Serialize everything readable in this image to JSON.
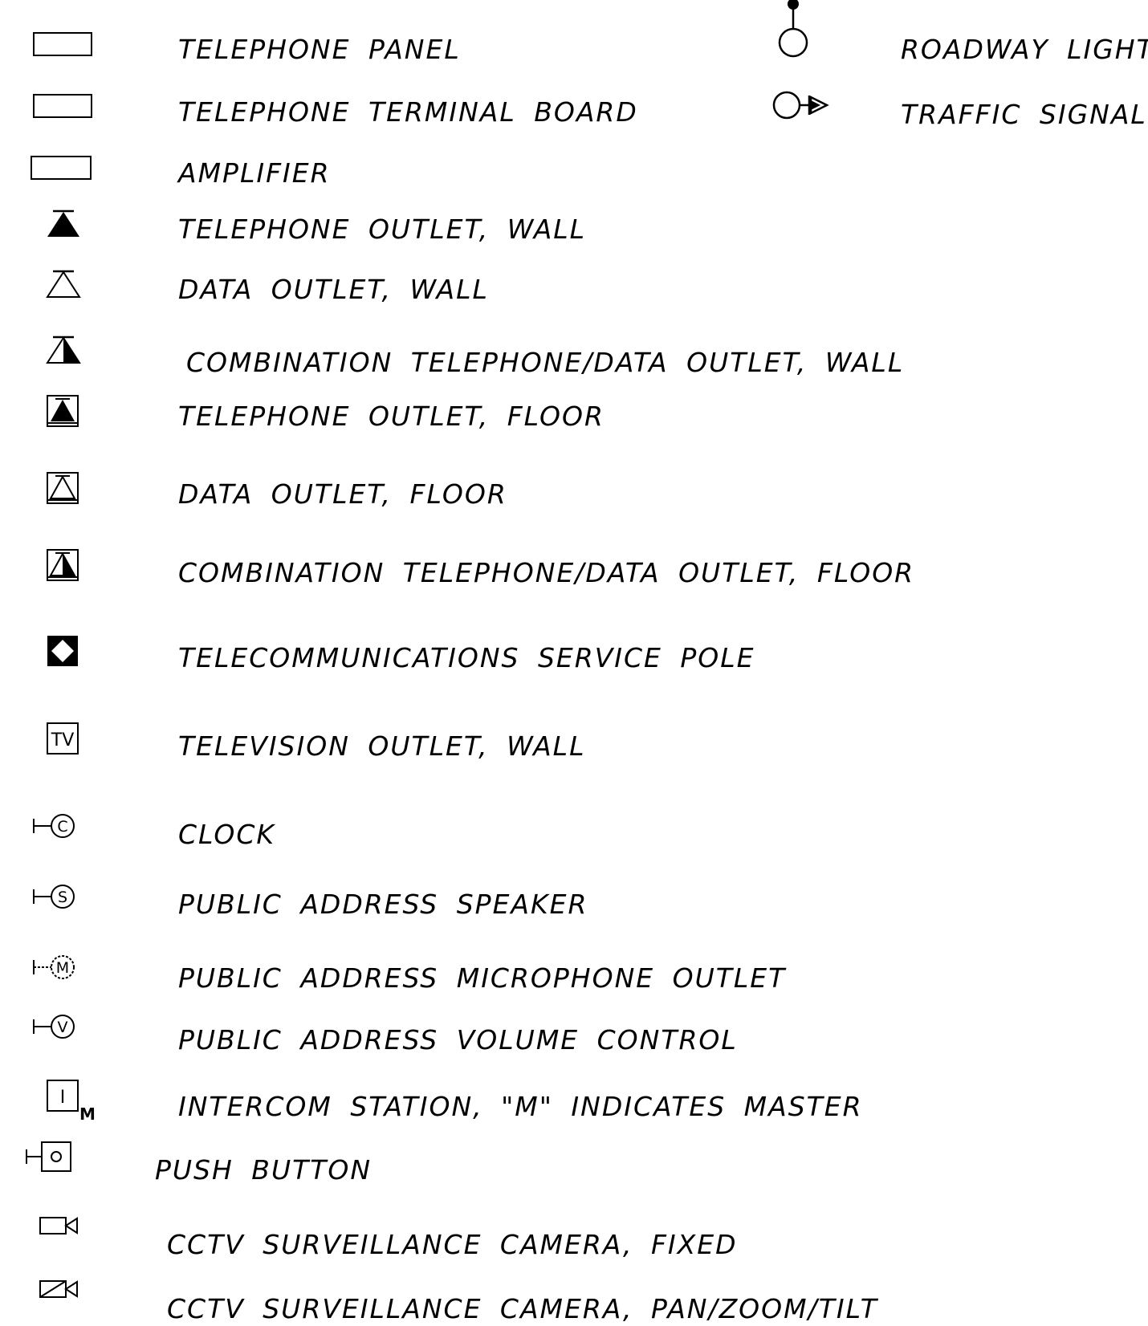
{
  "legend_left": [
    {
      "symbol": "panel-rect-icon",
      "label": "TELEPHONE  PANEL"
    },
    {
      "symbol": "terminal-board-rect-icon",
      "label": "TELEPHONE  TERMINAL  BOARD"
    },
    {
      "symbol": "amplifier-rect-icon",
      "label": "AMPLIFIER"
    },
    {
      "symbol": "filled-triangle-icon",
      "label": "TELEPHONE  OUTLET, WALL"
    },
    {
      "symbol": "open-triangle-icon",
      "label": "DATA  OUTLET, WALL"
    },
    {
      "symbol": "half-filled-triangle-icon",
      "label": "COMBINATION  TELEPHONE/DATA  OUTLET, WALL"
    },
    {
      "symbol": "boxed-filled-triangle-icon",
      "label": "TELEPHONE  OUTLET, FLOOR"
    },
    {
      "symbol": "boxed-open-triangle-icon",
      "label": "DATA  OUTLET, FLOOR"
    },
    {
      "symbol": "boxed-half-triangle-icon",
      "label": "COMBINATION  TELEPHONE/DATA  OUTLET, FLOOR"
    },
    {
      "symbol": "diamond-in-square-icon",
      "label": "TELECOMMUNICATIONS  SERVICE  POLE"
    },
    {
      "symbol": "tv-box-icon",
      "label": "TELEVISION  OUTLET, WALL",
      "glyph": "TV"
    },
    {
      "symbol": "clock-icon",
      "label": "CLOCK",
      "glyph": "C"
    },
    {
      "symbol": "speaker-icon",
      "label": "PUBLIC  ADDRESS  SPEAKER",
      "glyph": "S"
    },
    {
      "symbol": "microphone-outlet-icon",
      "label": "PUBLIC  ADDRESS  MICROPHONE  OUTLET",
      "glyph": "M"
    },
    {
      "symbol": "volume-control-icon",
      "label": "PUBLIC  ADDRESS  VOLUME  CONTROL",
      "glyph": "V"
    },
    {
      "symbol": "intercom-icon",
      "label": "INTERCOM  STATION, \"M\" INDICATES  MASTER",
      "glyph": "I",
      "sub": "M"
    },
    {
      "symbol": "push-button-icon",
      "label": "PUSH  BUTTON"
    },
    {
      "symbol": "fixed-camera-icon",
      "label": "CCTV  SURVEILLANCE  CAMERA, FIXED"
    },
    {
      "symbol": "ptz-camera-icon",
      "label": "CCTV  SURVEILLANCE  CAMERA, PAN/ZOOM/TILT"
    }
  ],
  "legend_right": [
    {
      "symbol": "roadway-light-icon",
      "label": "ROADWAY  LIGHT"
    },
    {
      "symbol": "traffic-signal-icon",
      "label": "TRAFFIC  SIGNAL"
    }
  ]
}
